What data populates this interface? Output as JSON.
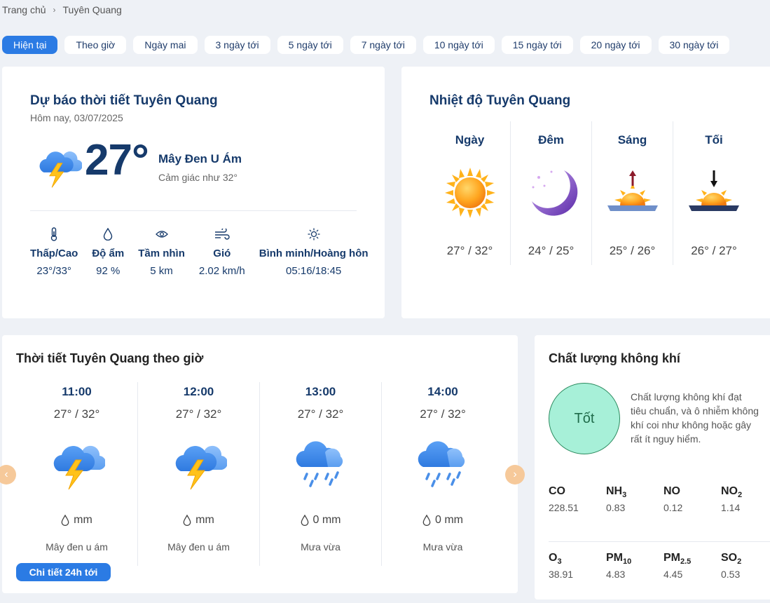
{
  "breadcrumb": {
    "home": "Trang chủ",
    "current": "Tuyên Quang"
  },
  "tabs": [
    "Hiện tại",
    "Theo giờ",
    "Ngày mai",
    "3 ngày tới",
    "5 ngày tới",
    "7 ngày tới",
    "10 ngày tới",
    "15 ngày tới",
    "20 ngày tới",
    "30 ngày tới"
  ],
  "current": {
    "title": "Dự báo thời tiết Tuyên Quang",
    "date": "Hôm nay, 03/07/2025",
    "temp": "27°",
    "condition": "Mây Đen U Ám",
    "feels_like": "Cảm giác như 32°",
    "icon": "thunderstorm-cloud-icon",
    "stats": [
      {
        "icon": "thermometer-icon",
        "label": "Thấp/Cao",
        "value": "23°/33°"
      },
      {
        "icon": "humidity-drop-icon",
        "label": "Độ ẩm",
        "value": "92 %"
      },
      {
        "icon": "visibility-eye-icon",
        "label": "Tầm nhìn",
        "value": "5 km"
      },
      {
        "icon": "wind-icon",
        "label": "Gió",
        "value": "2.02 km/h"
      },
      {
        "icon": "sun-icon",
        "label": "Bình minh/Hoàng hôn",
        "value": "05:16/18:45"
      }
    ]
  },
  "temperature": {
    "title": "Nhiệt độ Tuyên Quang",
    "periods": [
      {
        "label": "Ngày",
        "value": "27° / 32°",
        "icon": "sun-icon"
      },
      {
        "label": "Đêm",
        "value": "24° / 25°",
        "icon": "moon-icon"
      },
      {
        "label": "Sáng",
        "value": "25° / 26°",
        "icon": "sunrise-icon"
      },
      {
        "label": "Tối",
        "value": "26° / 27°",
        "icon": "sunset-icon"
      }
    ]
  },
  "hourly": {
    "title": "Thời tiết Tuyên Quang theo giờ",
    "detail_button": "Chi tiết 24h tới",
    "hours": [
      {
        "time": "11:00",
        "temp": "27° / 32°",
        "rain": "mm",
        "desc": "Mây đen u ám",
        "icon": "thunderstorm-cloud-icon"
      },
      {
        "time": "12:00",
        "temp": "27° / 32°",
        "rain": "mm",
        "desc": "Mây đen u ám",
        "icon": "thunderstorm-cloud-icon"
      },
      {
        "time": "13:00",
        "temp": "27° / 32°",
        "rain": "0 mm",
        "desc": "Mưa vừa",
        "icon": "rain-cloud-icon"
      },
      {
        "time": "14:00",
        "temp": "27° / 32°",
        "rain": "0 mm",
        "desc": "Mưa vừa",
        "icon": "rain-cloud-icon"
      }
    ]
  },
  "air": {
    "title": "Chất lượng không khí",
    "status": "Tốt",
    "description": "Chất lượng không khí đạt tiêu chuẩn, và ô nhiễm không khí coi như không hoặc gây rất ít nguy hiểm.",
    "pollutants": [
      {
        "name": "CO",
        "sub": "",
        "value": "228.51"
      },
      {
        "name": "NH",
        "sub": "3",
        "value": "0.83"
      },
      {
        "name": "NO",
        "sub": "",
        "value": "0.12"
      },
      {
        "name": "NO",
        "sub": "2",
        "value": "1.14"
      },
      {
        "name": "O",
        "sub": "3",
        "value": "38.91"
      },
      {
        "name": "PM",
        "sub": "10",
        "value": "4.83"
      },
      {
        "name": "PM",
        "sub": "2.5",
        "value": "4.45"
      },
      {
        "name": "SO",
        "sub": "2",
        "value": "0.53"
      }
    ]
  },
  "colors": {
    "accent": "#2b7be4",
    "title": "#163a6b",
    "aq_good": "#a7f0d8",
    "arrow": "#f6c99a"
  }
}
